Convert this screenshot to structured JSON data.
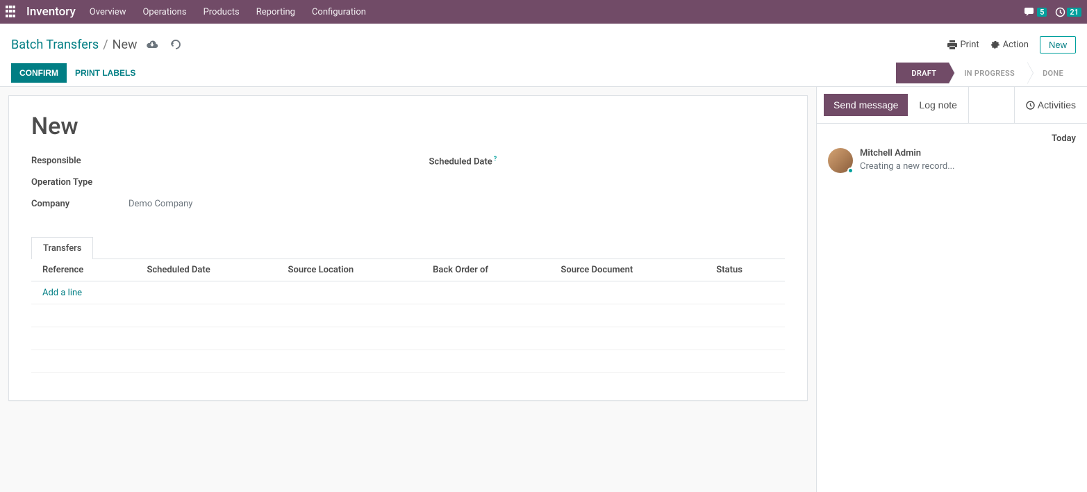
{
  "nav": {
    "brand": "Inventory",
    "items": [
      "Overview",
      "Operations",
      "Products",
      "Reporting",
      "Configuration"
    ],
    "messages_count": "5",
    "activities_count": "21"
  },
  "breadcrumb": {
    "root": "Batch Transfers",
    "leaf": "New"
  },
  "actions": {
    "print": "Print",
    "action": "Action",
    "new": "New"
  },
  "buttons": {
    "confirm": "CONFIRM",
    "print_labels": "PRINT LABELS"
  },
  "status": {
    "steps": [
      "DRAFT",
      "IN PROGRESS",
      "DONE"
    ],
    "active": 0
  },
  "sheet": {
    "title": "New",
    "fields": {
      "responsible": {
        "label": "Responsible",
        "value": ""
      },
      "operation_type": {
        "label": "Operation Type",
        "value": ""
      },
      "company": {
        "label": "Company",
        "value": "Demo Company"
      },
      "scheduled_date": {
        "label": "Scheduled Date",
        "value": ""
      }
    }
  },
  "tabs": {
    "transfers": "Transfers"
  },
  "table": {
    "cols": [
      "Reference",
      "Scheduled Date",
      "Source Location",
      "Back Order of",
      "Source Document",
      "Status"
    ],
    "add_line": "Add a line"
  },
  "chatter": {
    "send": "Send message",
    "log": "Log note",
    "activities": "Activities",
    "today": "Today",
    "msg": {
      "author": "Mitchell Admin",
      "text": "Creating a new record..."
    }
  }
}
